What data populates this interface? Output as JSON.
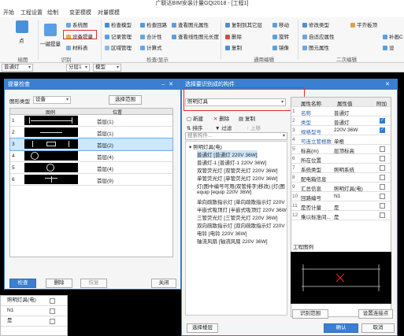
{
  "window": {
    "title": "广联达BIM安装计量GQI2018 - [工程1]"
  },
  "menu": [
    "开始",
    "工程设置",
    "绘制",
    "变更模模",
    "对量模模"
  ],
  "ribbon": {
    "dot_label": "点",
    "draw_group": "绘图",
    "one_key": "一键提量",
    "system_map": "系统图",
    "device_extract": "设备提量",
    "material_table": "材料表",
    "identify_group": "识别",
    "check_model": "检查模型",
    "record_manage": "记录管理",
    "region_manage": "区域管理",
    "check_loop": "检查回路",
    "merge_stat": "合计性",
    "calc_formula": "计算式",
    "check_group": "检查/显示",
    "view_layer_prop": "查看图元属性",
    "view_line_len": "查看线性图元长度",
    "copy_layer": "复制到其它层",
    "delete": "删除",
    "copy": "复制",
    "move": "移动",
    "rotate": "旋转",
    "mirror": "镜像",
    "general_group": "通用编辑",
    "modify_type": "修改类型",
    "auto_type": "自适应属性",
    "layer_prop": "图元属性",
    "secondary_group": "二次编辑",
    "flat_board": "平齐板顶",
    "fill_pipe": "补画C",
    "set_": "设"
  },
  "combos": [
    "普通灯",
    "分层1",
    "模型"
  ],
  "dialog1": {
    "title": "提量检查",
    "layer_type_label": "图形类型",
    "layer_type_value": "设备",
    "select_range": "选择范围",
    "col_shape": "图例",
    "col_pos": "位置",
    "rows": [
      {
        "n": "1",
        "pos": "首层(1)"
      },
      {
        "n": "2",
        "pos": "首层(1)"
      },
      {
        "n": "3",
        "pos": "首层(2)"
      },
      {
        "n": "4",
        "pos": "首层(4)"
      },
      {
        "n": "5",
        "pos": "首层(4)"
      },
      {
        "n": "6",
        "pos": "首层(9)"
      }
    ],
    "check": "检查",
    "delete": "删除",
    "restore": "恢复",
    "close": "关闭"
  },
  "props_left": [
    "照明灯具(电)",
    "N1",
    "是"
  ],
  "dialog2": {
    "title": "选择要识别成的构件",
    "type_value": "照明灯具",
    "new": "新建",
    "delete": "删除",
    "copy": "复制",
    "sort": "排序",
    "filter": "过滤",
    "up": "上移",
    "search_placeholder": "搜索构件...",
    "tree_root": "照明灯具(电)",
    "tree_items": [
      "普通灯 [普通灯 220V 36W]",
      "普通灯-1 [普通灯-1 220V 36W]",
      "双管荧光灯 [双管荧光灯 220V 36W]",
      "单管荧光灯 [单管荧光灯 220V 36W]",
      "灯(图中编号可用(双管排字)移改) [灯(图",
      "equip [equip 220V 36W]",
      "单向疏散指示灯 [单向疏散指示灯 220V",
      "半嵌式吸顶灯 [半嵌式吸顶灯 220V 36W",
      "三管荧光灯 [三管荧光灯 220V 36W]",
      "双向疏散指示灯 [双向疏散指示灯 220V",
      "电铃 [电铃 220V 36W]",
      "轴流风扇 [轴流风扇 220V 36W]"
    ],
    "prop_headers": [
      "属性名称",
      "属性值",
      "附加"
    ],
    "props": [
      {
        "i": "1",
        "k": "名称",
        "v": "普通灯",
        "blue": true,
        "chk": null
      },
      {
        "i": "2",
        "k": "类型",
        "v": "普通灯",
        "blue": true,
        "chk": true
      },
      {
        "i": "3",
        "k": "规格型号",
        "v": "220V 36W",
        "blue": true,
        "chk": true
      },
      {
        "i": "4",
        "k": "可连立管根数",
        "v": "单根",
        "blue": true,
        "chk": null
      },
      {
        "i": "5",
        "k": "标高(m)",
        "v": "层顶标高",
        "blue": false,
        "chk": false
      },
      {
        "i": "6",
        "k": "所在位置",
        "v": "",
        "blue": false,
        "chk": false
      },
      {
        "i": "7",
        "k": "系统类型",
        "v": "照明系统",
        "blue": false,
        "chk": false
      },
      {
        "i": "8",
        "k": "配电箱信息",
        "v": "",
        "blue": false,
        "chk": false
      },
      {
        "i": "9",
        "k": "汇总信息",
        "v": "照明灯具(电)",
        "blue": false,
        "chk": false
      },
      {
        "i": "10",
        "k": "回路编号",
        "v": "N1",
        "blue": false,
        "chk": false
      },
      {
        "i": "11",
        "k": "是否计量",
        "v": "是",
        "blue": false,
        "chk": false
      },
      {
        "i": "12",
        "k": "乘以标准间...",
        "v": "是",
        "blue": false,
        "chk": false
      }
    ],
    "preview_label": "工程图例",
    "identify_range": "识别范围",
    "set_connection": "设置连接点",
    "select_floor": "选择楼层",
    "ok": "确认",
    "cancel": "取消"
  }
}
